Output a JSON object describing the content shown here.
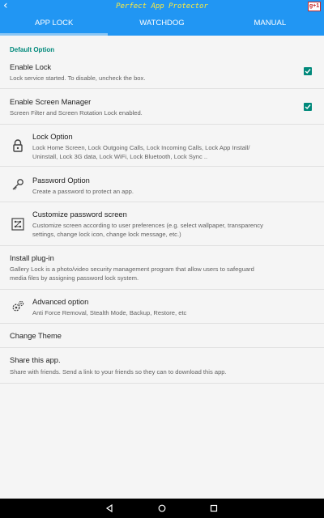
{
  "header": {
    "back_icon": "back-arrow-icon",
    "title": "Perfect  App Protector",
    "gplus_label": "g+1"
  },
  "tabs": [
    {
      "label": "APP LOCK",
      "active": true
    },
    {
      "label": "WATCHDOG",
      "active": false
    },
    {
      "label": "MANUAL",
      "active": false
    }
  ],
  "section_label": "Default Option",
  "settings": {
    "enable_lock": {
      "title": "Enable Lock",
      "subtitle": "Lock service started. To disable, uncheck the box.",
      "checked": true
    },
    "screen_manager": {
      "title": "Enable Screen Manager",
      "subtitle": "Screen Filter and Screen Rotation Lock enabled.",
      "checked": true
    },
    "lock_option": {
      "title": "Lock Option",
      "subtitle_1": "Lock Home Screen, Lock Outgoing Calls, Lock Incoming Calls, Lock App Install/",
      "subtitle_2": "Uninstall, Lock 3G data, Lock WiFi, Lock Bluetooth, Lock Sync ..",
      "icon": "lock-icon"
    },
    "password_option": {
      "title": "Password Option",
      "subtitle": "Create a password to protect an app.",
      "icon": "key-icon"
    },
    "customize_password": {
      "title": "Customize password screen",
      "subtitle_1": "Customize screen according to user preferences (e.g. select wallpaper, transparency",
      "subtitle_2": "settings, change lock icon, change lock message, etc.)",
      "icon": "pattern-grid-icon"
    },
    "install_plugin": {
      "title": "Install plug-in",
      "subtitle_1": "Gallery Lock is a photo/video security management program that allow users to safeguard",
      "subtitle_2": "media files by assigning password lock system."
    },
    "advanced_option": {
      "title": "Advanced option",
      "subtitle": "Anti Force Removal, Stealth Mode, Backup, Restore, etc",
      "icon": "gears-icon"
    },
    "change_theme": {
      "title": "Change Theme"
    },
    "share_app": {
      "title": "Share this app.",
      "subtitle": "Share with friends. Send a link to your friends so they can to download this app."
    }
  },
  "colors": {
    "primary": "#2196f3",
    "accent": "#00897b",
    "title_text": "#ffeb3b"
  },
  "navbar": {
    "icons": [
      "back-triangle-icon",
      "home-circle-icon",
      "recents-square-icon"
    ]
  }
}
